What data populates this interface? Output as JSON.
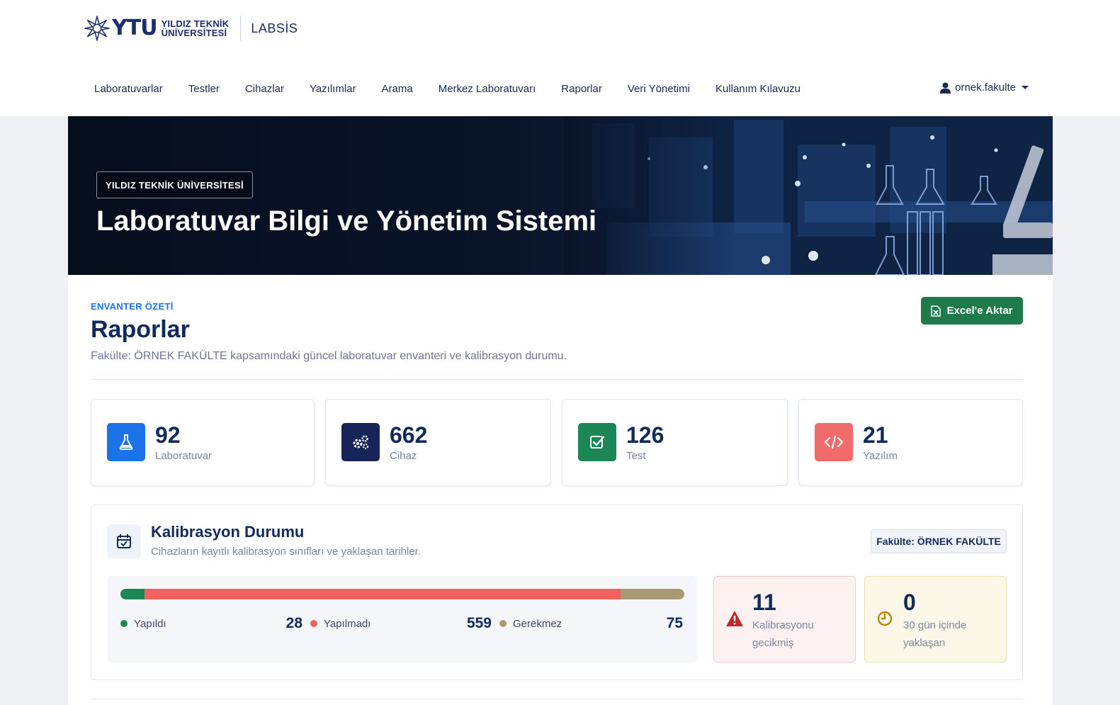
{
  "brand": {
    "logo_mark": "YTU",
    "university_line1": "YILDIZ TEKNİK",
    "university_line2": "ÜNİVERSİTESİ",
    "app_name": "LABSİS"
  },
  "nav": {
    "items": [
      {
        "label": "Laboratuvarlar"
      },
      {
        "label": "Testler"
      },
      {
        "label": "Cihazlar"
      },
      {
        "label": "Yazılımlar"
      },
      {
        "label": "Arama"
      },
      {
        "label": "Merkez Laboratuvarı"
      },
      {
        "label": "Raporlar"
      },
      {
        "label": "Veri Yönetimi"
      },
      {
        "label": "Kullanım Kılavuzu"
      }
    ],
    "user": "ornek.fakulte"
  },
  "hero": {
    "chip": "YILDIZ TEKNİK ÜNİVERSİTESİ",
    "title": "Laboratuvar Bilgi ve Yönetim Sistemi"
  },
  "page": {
    "eyebrow": "ENVANTER ÖZETİ",
    "title": "Raporlar",
    "subtitle": "Fakülte: ÖRNEK FAKÜLTE kapsamındaki güncel laboratuvar envanteri ve kalibrasyon durumu.",
    "export_label": "Excel'e Aktar"
  },
  "stats": [
    {
      "value": "92",
      "label": "Laboratuvar",
      "icon": "flask-icon",
      "color": "#1a73e8"
    },
    {
      "value": "662",
      "label": "Cihaz",
      "icon": "gears-icon",
      "color": "#16245a"
    },
    {
      "value": "126",
      "label": "Test",
      "icon": "checkbox-icon",
      "color": "#1a8754"
    },
    {
      "value": "21",
      "label": "Yazılım",
      "icon": "code-icon",
      "color": "#f26b6b"
    }
  ],
  "calibration": {
    "title": "Kalibrasyon Durumu",
    "subtitle": "Cihazların kayıtlı kalibrasyon sınıfları ve yaklaşan tarihler.",
    "faculty_badge": "Fakülte: ÖRNEK FAKÜLTE",
    "segments": [
      {
        "label": "Yapıldı",
        "count": 28,
        "color": "#1a8754"
      },
      {
        "label": "Yapılmadı",
        "count": 559,
        "color": "#f2615e"
      },
      {
        "label": "Gerekmez",
        "count": 75,
        "color": "#a89a72"
      }
    ],
    "overdue": {
      "value": "11",
      "text": "Kalibrasyonu gecikmiş",
      "color": "#c62828"
    },
    "upcoming": {
      "value": "0",
      "text": "30 gün içinde yaklaşan",
      "color": "#b8860b"
    }
  }
}
